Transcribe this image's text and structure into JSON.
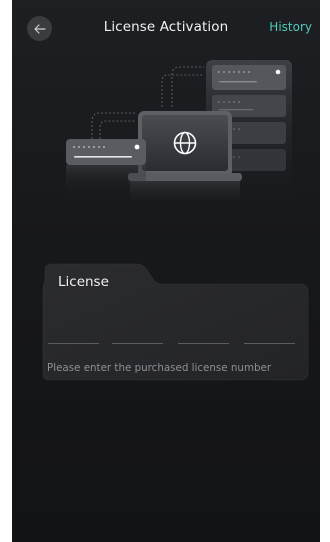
{
  "header": {
    "title": "License Activation",
    "history_label": "History"
  },
  "license": {
    "label": "License",
    "hint": "Please enter the purchased license number",
    "segment_count": 4
  },
  "colors": {
    "accent": "#4fc9b7",
    "background": "#1a1b1e",
    "card": "#26272b"
  },
  "icons": {
    "back": "arrow-left-icon",
    "globe": "globe-icon"
  }
}
